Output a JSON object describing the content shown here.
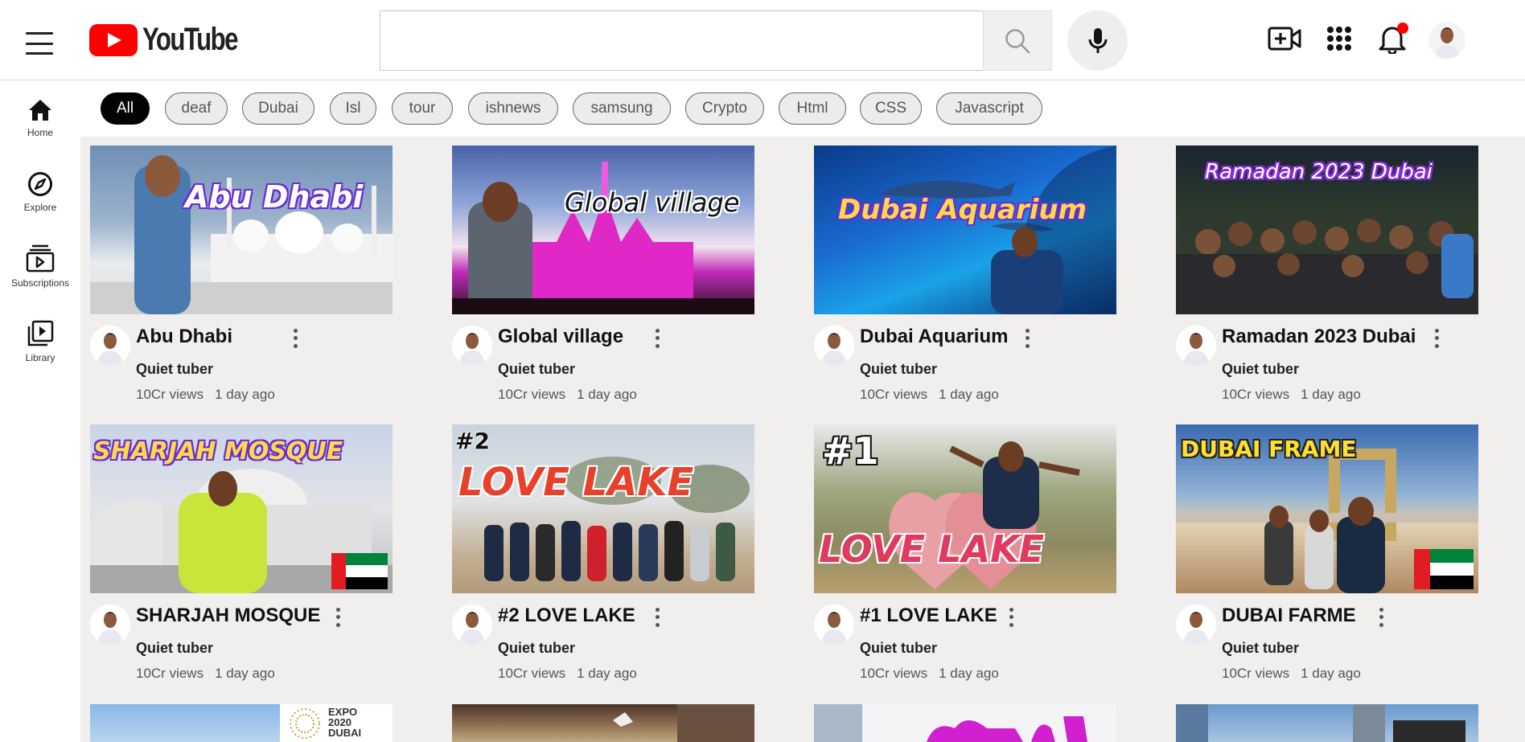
{
  "header": {
    "logo_text": "YouTube",
    "search_placeholder": "",
    "icons": [
      "menu-icon",
      "search-icon",
      "mic-icon",
      "create-video-icon",
      "apps-grid-icon",
      "bell-icon"
    ]
  },
  "sidebar": {
    "items": [
      {
        "label": "Home",
        "icon": "home-icon"
      },
      {
        "label": "Explore",
        "icon": "compass-icon"
      },
      {
        "label": "Subscriptions",
        "icon": "subscriptions-icon"
      },
      {
        "label": "Library",
        "icon": "library-icon"
      }
    ]
  },
  "chips": [
    "All",
    "deaf",
    "Dubai",
    "Isl",
    "tour",
    "ishnews",
    "samsung",
    "Crypto",
    "Html",
    "CSS",
    "Javascript"
  ],
  "videos": [
    {
      "title": "Abu Dhabi",
      "channel": "Quiet tuber",
      "views": "10Cr views",
      "age": "1 day ago",
      "thumb_text": "Abu Dhabi"
    },
    {
      "title": "Global village",
      "channel": "Quiet tuber",
      "views": "10Cr views",
      "age": "1 day ago",
      "thumb_text": "Global village"
    },
    {
      "title": "Dubai Aquarium",
      "channel": "Quiet tuber",
      "views": "10Cr views",
      "age": "1 day ago",
      "thumb_text": "Dubai Aquarium"
    },
    {
      "title": "Ramadan 2023 Dubai",
      "channel": "Quiet tuber",
      "views": "10Cr views",
      "age": "1 day ago",
      "thumb_text": "Ramadan 2023 Dubai"
    },
    {
      "title": "SHARJAH MOSQUE",
      "channel": "Quiet tuber",
      "views": "10Cr views",
      "age": "1 day ago",
      "thumb_text": "SHARJAH MOSQUE"
    },
    {
      "title": "#2 LOVE LAKE",
      "channel": "Quiet tuber",
      "views": "10Cr views",
      "age": "1 day ago",
      "thumb_text": "LOVE LAKE",
      "thumb_badge": "#2"
    },
    {
      "title": "#1 LOVE LAKE",
      "channel": "Quiet tuber",
      "views": "10Cr views",
      "age": "1 day ago",
      "thumb_text": "LOVE LAKE",
      "thumb_badge": "#1"
    },
    {
      "title": "DUBAI FARME",
      "channel": "Quiet tuber",
      "views": "10Cr views",
      "age": "1 day ago",
      "thumb_text": "DUBAI FRAME"
    }
  ],
  "partial_row": {
    "expo_text": "EXPO 2020 DUBAI"
  },
  "colors": {
    "brand_red": "#ff0000",
    "chip_active_bg": "#030303",
    "main_bg": "#f1eeee"
  }
}
